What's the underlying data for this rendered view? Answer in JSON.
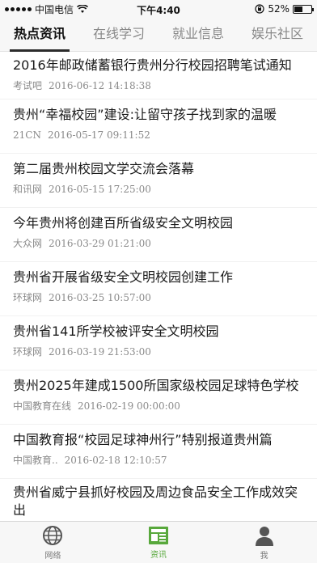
{
  "status_bar": {
    "carrier": "中国电信",
    "time": "下午4:40",
    "battery": "52%",
    "battery_level": 0.52
  },
  "tabs": [
    {
      "label": "热点资讯",
      "active": true
    },
    {
      "label": "在线学习",
      "active": false
    },
    {
      "label": "就业信息",
      "active": false
    },
    {
      "label": "娱乐社区",
      "active": false
    }
  ],
  "news": [
    {
      "title": "2016年邮政储蓄银行贵州分行校园招聘笔试通知",
      "source": "考试吧",
      "date": "2016-06-12 14:18:38"
    },
    {
      "title": "贵州“幸福校园”建设:让留守孩子找到家的温暖",
      "source": "21CN",
      "date": "2016-05-17 09:11:52"
    },
    {
      "title": "第二届贵州校园文学交流会落幕",
      "source": "和讯网",
      "date": "2016-05-15 17:25:00"
    },
    {
      "title": "今年贵州将创建百所省级安全文明校园",
      "source": "大众网",
      "date": "2016-03-29 01:21:00"
    },
    {
      "title": "贵州省开展省级安全文明校园创建工作",
      "source": "环球网",
      "date": "2016-03-25 10:57:00"
    },
    {
      "title": "贵州省141所学校被评安全文明校园",
      "source": "环球网",
      "date": "2016-03-19 21:53:00"
    },
    {
      "title": "贵州2025年建成1500所国家级校园足球特色学校",
      "source": "中国教育在线",
      "date": "2016-02-19 00:00:00"
    },
    {
      "title": "中国教育报“校园足球神州行”特别报道贵州篇",
      "source": "中国教育..",
      "date": "2016-02-18 12:10:57"
    },
    {
      "title": "贵州省威宁县抓好校园及周边食品安全工作成效突出",
      "source": "",
      "date": ""
    }
  ],
  "bottom_nav": [
    {
      "label": "网络",
      "icon": "globe-icon",
      "active": false
    },
    {
      "label": "资讯",
      "icon": "news-icon",
      "active": true
    },
    {
      "label": "我",
      "icon": "person-icon",
      "active": false
    }
  ],
  "colors": {
    "accent": "#58a83c",
    "tab_indicator": "#2b2b2b"
  }
}
